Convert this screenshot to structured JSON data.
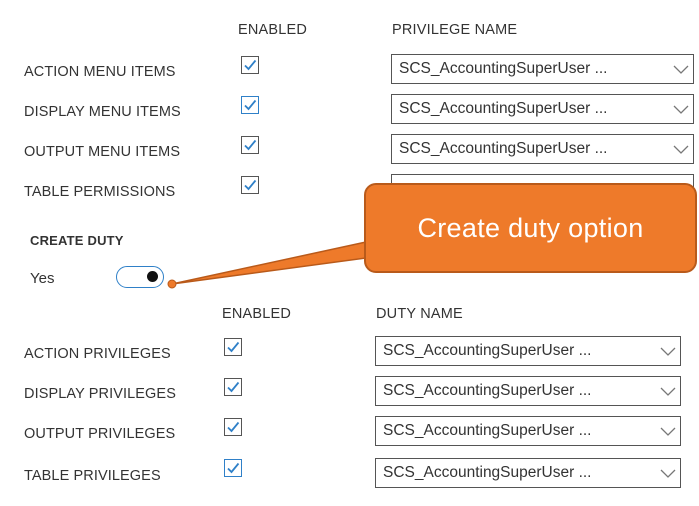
{
  "menu_section": {
    "enabled_header": "ENABLED",
    "name_header": "PRIVILEGE NAME",
    "rows": [
      {
        "label": "ACTION MENU ITEMS",
        "value": "SCS_AccountingSuperUser ...",
        "checked": true
      },
      {
        "label": "DISPLAY MENU ITEMS",
        "value": "SCS_AccountingSuperUser ...",
        "checked": true
      },
      {
        "label": "OUTPUT MENU ITEMS",
        "value": "SCS_AccountingSuperUser ...",
        "checked": true
      },
      {
        "label": "TABLE PERMISSIONS",
        "value": "",
        "checked": true
      }
    ]
  },
  "create_duty": {
    "title": "CREATE DUTY",
    "toggle_label": "Yes",
    "toggle_on": true
  },
  "duty_section": {
    "enabled_header": "ENABLED",
    "name_header": "DUTY NAME",
    "rows": [
      {
        "label": "ACTION PRIVILEGES",
        "value": "SCS_AccountingSuperUser ...",
        "checked": true
      },
      {
        "label": "DISPLAY PRIVILEGES",
        "value": "SCS_AccountingSuperUser ...",
        "checked": true
      },
      {
        "label": "OUTPUT PRIVILEGES",
        "value": "SCS_AccountingSuperUser ...",
        "checked": true
      },
      {
        "label": "TABLE PRIVILEGES",
        "value": "SCS_AccountingSuperUser ...",
        "checked": true
      }
    ]
  },
  "callout": {
    "text": "Create duty option"
  },
  "colors": {
    "accent_blue": "#2f80c8",
    "callout_orange": "#ee7a2a"
  }
}
